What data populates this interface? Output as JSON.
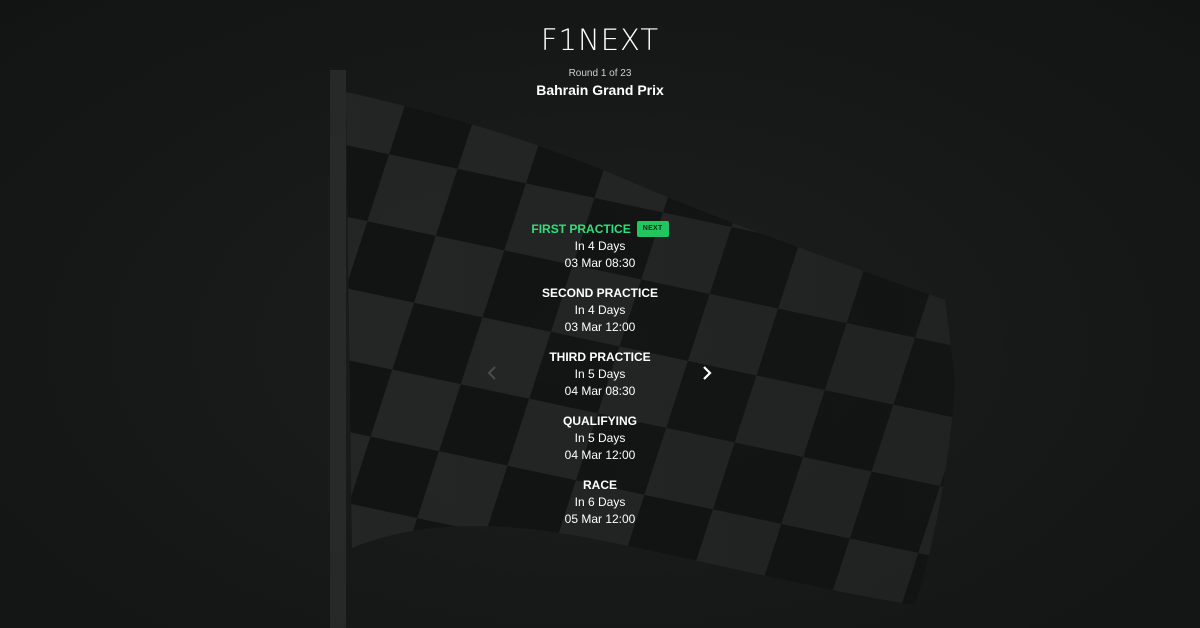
{
  "app": {
    "logo_text": "F1NEXT"
  },
  "race": {
    "round_label": "Round 1 of 23",
    "name": "Bahrain Grand Prix"
  },
  "sessions": [
    {
      "name": "FIRST PRACTICE",
      "countdown": "In 4 Days",
      "datetime": "03 Mar 08:30",
      "badge": "NEXT"
    },
    {
      "name": "SECOND PRACTICE",
      "countdown": "In 4 Days",
      "datetime": "03 Mar 12:00"
    },
    {
      "name": "THIRD PRACTICE",
      "countdown": "In 5 Days",
      "datetime": "04 Mar 08:30"
    },
    {
      "name": "QUALIFYING",
      "countdown": "In 5 Days",
      "datetime": "04 Mar 12:00"
    },
    {
      "name": "RACE",
      "countdown": "In 6 Days",
      "datetime": "05 Mar 12:00"
    }
  ],
  "navigation": {
    "prev_icon": "chevron-left-icon",
    "next_icon": "chevron-right-icon",
    "prev_enabled": false,
    "next_enabled": true
  },
  "colors": {
    "background": "#1b1c1c",
    "next_session_accent": "#2fe07a",
    "badge_background": "#22c55e"
  }
}
